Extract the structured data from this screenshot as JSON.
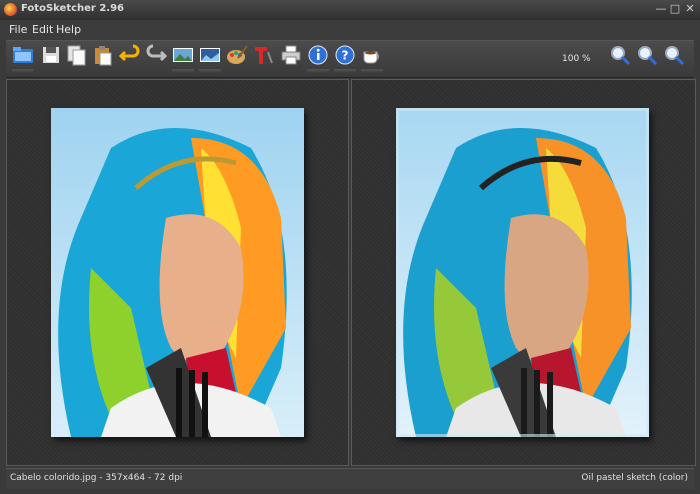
{
  "window": {
    "title": "FotoSketcher 2.96"
  },
  "menu": {
    "items": [
      "File",
      "Edit",
      "Help"
    ]
  },
  "toolbar": {
    "buttons": [
      "open-folder-icon",
      "save-icon",
      "copy-icon",
      "paste-icon",
      "undo-icon",
      "redo-icon",
      "process-image-icon",
      "compare-image-icon",
      "paint-palette-icon",
      "add-text-icon",
      "print-icon",
      "info-icon",
      "help-icon",
      "donate-coffee-icon",
      "zoom-in-icon",
      "zoom-fit-icon",
      "zoom-out-icon"
    ],
    "zoom_level": "100 %"
  },
  "status": {
    "file_info": "Cabelo colorido.jpg - 357x464 - 72 dpi",
    "effect": "Oil pastel sketch (color)"
  },
  "colors": {
    "background": "#3a3a3a",
    "hair_cyan": "#18b6e6",
    "hair_orange": "#ff8c1a",
    "hair_yellow": "#ffe33a",
    "sky": "#bfe2f5"
  }
}
